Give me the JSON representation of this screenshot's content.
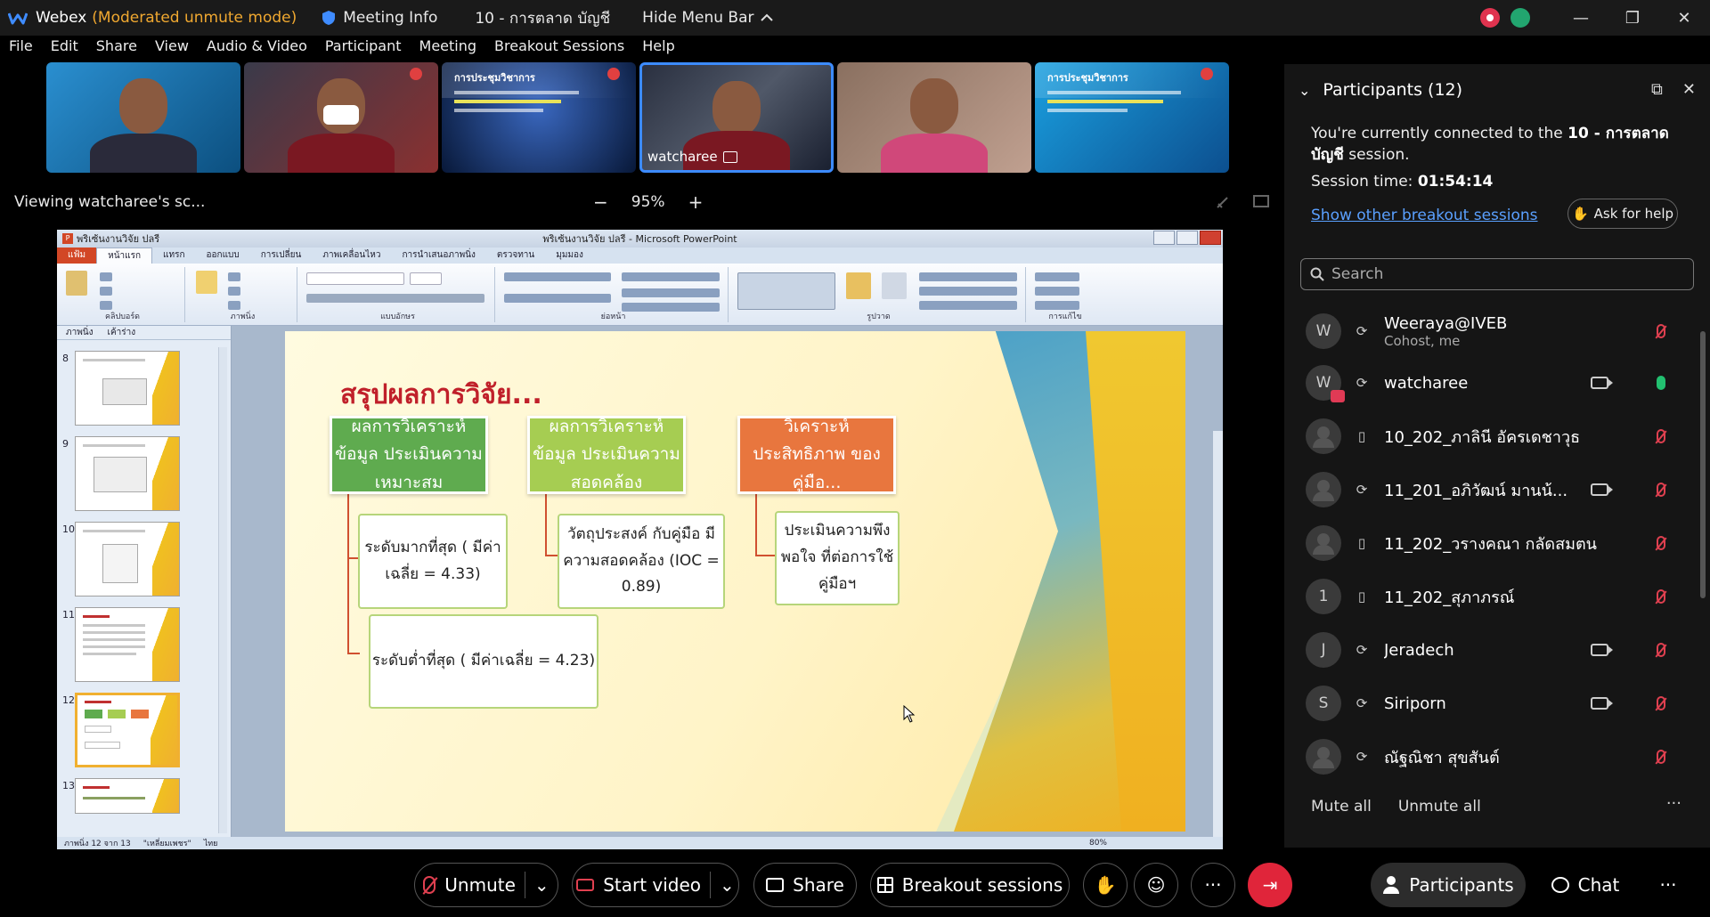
{
  "window": {
    "app_name": "Webex",
    "mode": "(Moderated unmute mode)",
    "meeting_info": "Meeting Info",
    "session_name": "10 - การตลาด บัญชี",
    "hide_menu": "Hide Menu Bar"
  },
  "menu": [
    "File",
    "Edit",
    "Share",
    "View",
    "Audio & Video",
    "Participant",
    "Meeting",
    "Breakout Sessions",
    "Help"
  ],
  "filmstrip": {
    "tiles": [
      {
        "name": "",
        "kind": "person"
      },
      {
        "name": "",
        "kind": "person"
      },
      {
        "name": "",
        "kind": "slide"
      },
      {
        "name": "watcharee",
        "kind": "person-active"
      },
      {
        "name": "",
        "kind": "person"
      },
      {
        "name": "",
        "kind": "slide"
      }
    ],
    "slide_tile_title": "การประชุมวิชาการ"
  },
  "view": {
    "viewing": "Viewing watcharee's sc...",
    "zoom_minus": "−",
    "zoom_level": "95%",
    "zoom_plus": "+"
  },
  "powerpoint": {
    "file_name": "พริเซ้นงานวิจัย ปลรี",
    "window_title": "พริเซ้นงานวิจัย ปลรี - Microsoft PowerPoint",
    "tabs": [
      "แฟ้ม",
      "หน้าแรก",
      "แทรก",
      "ออกแบบ",
      "การเปลี่ยน",
      "ภาพเคลื่อนไหว",
      "การนำเสนอภาพนิ่ง",
      "ตรวจทาน",
      "มุมมอง"
    ],
    "ribbon_groups": [
      "คลิปบอร์ด",
      "ภาพนิ่ง",
      "แบบอักษร",
      "ย่อหน้า",
      "รูปวาด",
      "การแก้ไข"
    ],
    "thumbs_tabs": [
      "ภาพนิ่ง",
      "เค้าร่าง"
    ],
    "slide_numbers": [
      "8",
      "9",
      "10",
      "11",
      "12",
      "13"
    ],
    "selected_slide": "12",
    "status": {
      "slide_of": "ภาพนิ่ง 12 จาก 13",
      "theme": "\"เหลี่ยมเพชร\"",
      "language": "ไทย",
      "zoom": "80%"
    }
  },
  "slide": {
    "title": "สรุปผลการวิจัย...",
    "box1": "ผลการวิเคราะห์ข้อมูล ประเมินความเหมาะสม",
    "box2": "ผลการวิเคราะห์ข้อมูล ประเมินความสอดคล้อง",
    "box3": "วิเคราะห์ประสิทธิภาพ ของคู่มือ...",
    "sub1": "ระดับมากที่สุด ( มีค่าเฉลี่ย = 4.33)",
    "sub2": "วัตถุประสงค์ กับคู่มือ มีความสอดคล้อง (IOC  = 0.89)",
    "sub3": "ประเมินความพึงพอใจ ที่ต่อการใช้คู่มือฯ",
    "sub4": "ระดับต่ำที่สุด ( มีค่าเฉลี่ย = 4.23)"
  },
  "participants_panel": {
    "title": "Participants (12)",
    "connected_prefix": "You're currently connected to the",
    "connected_session": "10 - การตลาด บัญชี",
    "connected_suffix": "session.",
    "session_time_label": "Session time:",
    "session_time": "01:54:14",
    "show_other": "Show other breakout sessions",
    "ask_help": "Ask for help",
    "search_placeholder": "Search",
    "list": [
      {
        "initial": "W",
        "name": "Weeraya@IVEB",
        "sub": "Cohost, me",
        "device": "sync",
        "video": false,
        "mic": "muted"
      },
      {
        "initial": "W",
        "name": "watcharee",
        "sub": "",
        "device": "sync",
        "video": true,
        "mic": "on"
      },
      {
        "initial": "",
        "name": "10_202_ภาลินี อัครเดชาวุธ",
        "sub": "",
        "device": "phone",
        "video": false,
        "mic": "muted"
      },
      {
        "initial": "",
        "name": "11_201_อภิวัฒน์ มานน้...",
        "sub": "",
        "device": "sync",
        "video": true,
        "mic": "muted"
      },
      {
        "initial": "",
        "name": "11_202_วรางคณา กลัดสมตน",
        "sub": "",
        "device": "phone",
        "video": false,
        "mic": "muted"
      },
      {
        "initial": "1",
        "name": "11_202_สุภาภรณ์",
        "sub": "",
        "device": "phone",
        "video": false,
        "mic": "muted"
      },
      {
        "initial": "J",
        "name": "Jeradech",
        "sub": "",
        "device": "sync",
        "video": true,
        "mic": "muted"
      },
      {
        "initial": "S",
        "name": "Siriporn",
        "sub": "",
        "device": "sync",
        "video": true,
        "mic": "muted"
      },
      {
        "initial": "",
        "name": "ณัฐณิชา สุขสันต์",
        "sub": "",
        "device": "sync",
        "video": false,
        "mic": "muted"
      }
    ],
    "mute_all": "Mute all",
    "unmute_all": "Unmute all"
  },
  "toolbar": {
    "unmute": "Unmute",
    "start_video": "Start video",
    "share": "Share",
    "breakout": "Breakout sessions",
    "participants": "Participants",
    "chat": "Chat"
  },
  "colors": {
    "accent_link": "#5aa0ff",
    "end_call": "#e0253a",
    "moderated_mode": "#f0a830",
    "muted_red": "#e04050",
    "mic_on_green": "#22c070"
  }
}
